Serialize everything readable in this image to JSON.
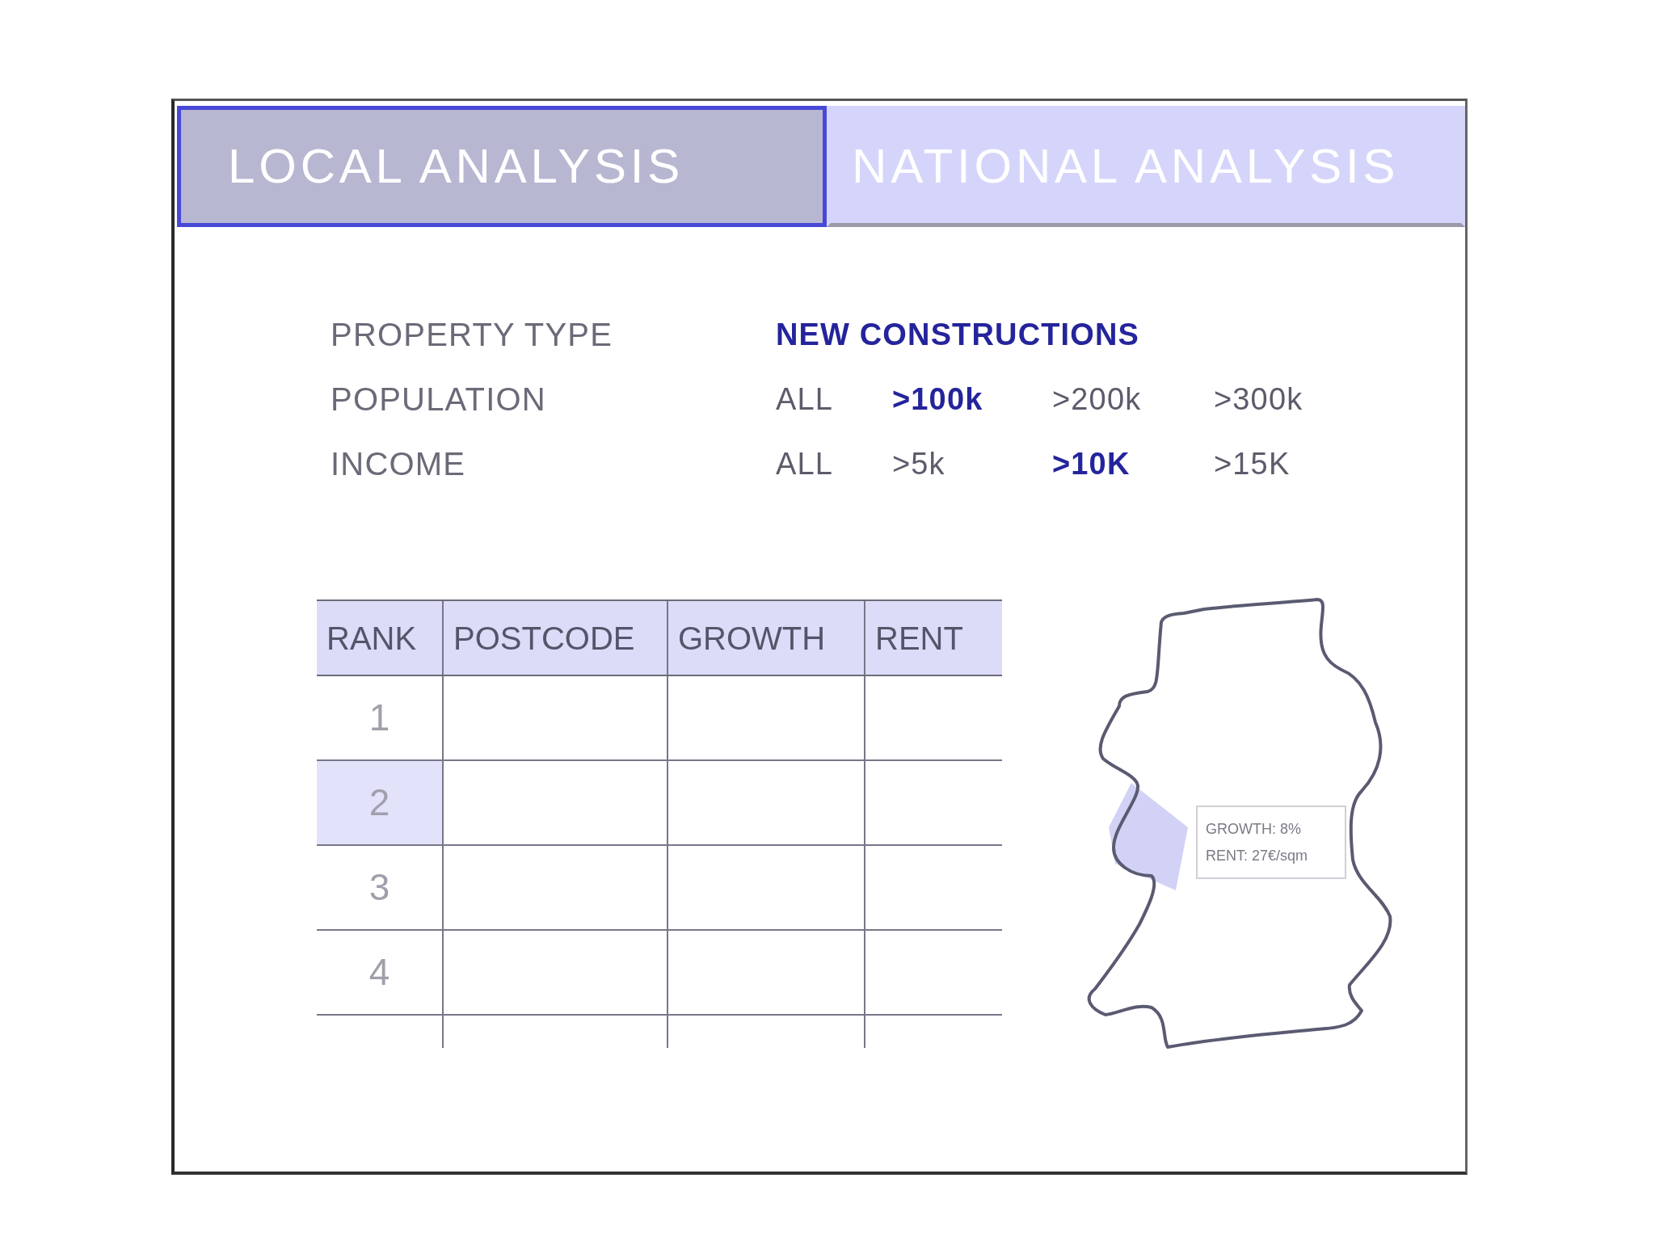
{
  "tabs": [
    {
      "label": "LOCAL ANALYSIS",
      "selected": true
    },
    {
      "label": "NATIONAL ANALYSIS",
      "selected": false
    }
  ],
  "filters": [
    {
      "label": "PROPERTY TYPE",
      "options": [
        {
          "label": "NEW CONSTRUCTIONS",
          "selected": true
        }
      ]
    },
    {
      "label": "POPULATION",
      "options": [
        {
          "label": "ALL",
          "selected": false
        },
        {
          "label": ">100k",
          "selected": true
        },
        {
          "label": ">200k",
          "selected": false
        },
        {
          "label": ">300k",
          "selected": false
        }
      ]
    },
    {
      "label": "INCOME",
      "options": [
        {
          "label": "ALL",
          "selected": false
        },
        {
          "label": ">5k",
          "selected": false
        },
        {
          "label": ">10K",
          "selected": true
        },
        {
          "label": ">15K",
          "selected": false
        }
      ]
    }
  ],
  "table": {
    "columns": [
      "RANK",
      "POSTCODE",
      "GROWTH",
      "RENT"
    ],
    "rows": [
      {
        "rank": "1",
        "selected": false
      },
      {
        "rank": "2",
        "selected": true
      },
      {
        "rank": "3",
        "selected": false
      },
      {
        "rank": "4",
        "selected": false
      }
    ]
  },
  "map": {
    "tooltip": [
      "GROWTH: 8%",
      "RENT: 27€/sqm"
    ]
  }
}
